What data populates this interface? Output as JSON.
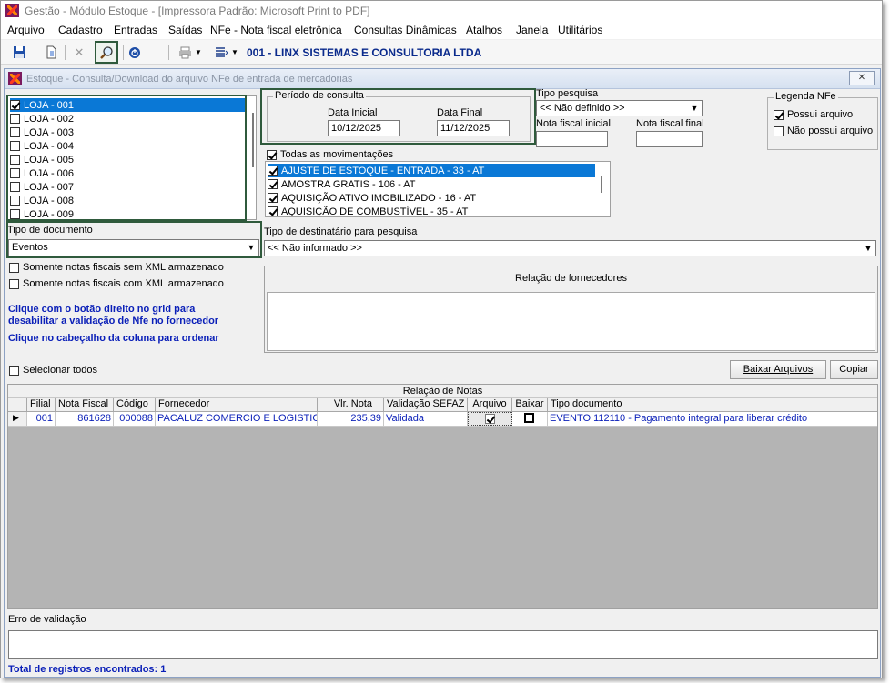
{
  "window": {
    "title": "Gestão  - Módulo Estoque - [Impressora Padrão: Microsoft Print to PDF]"
  },
  "menu": [
    "Arquivo",
    "Cadastro",
    "Entradas",
    "Saídas",
    "NFe - Nota fiscal eletrônica",
    "Consultas Dinâmicas",
    "Atalhos",
    "Janela",
    "Utilitários"
  ],
  "toolbar": {
    "company": "001 - LINX SISTEMAS E CONSULTORIA LTDA",
    "icons": [
      "save-icon",
      "new-document-icon",
      "close-icon",
      "search-icon",
      "power-icon",
      "printer-icon",
      "list-icon"
    ]
  },
  "form": {
    "title": "Estoque - Consulta/Download do arquivo NFe de entrada de mercadorias",
    "close_label": "✕"
  },
  "stores": [
    {
      "label": "LOJA - 001",
      "checked": true,
      "selected": true
    },
    {
      "label": "LOJA - 002",
      "checked": false
    },
    {
      "label": "LOJA - 003",
      "checked": false
    },
    {
      "label": "LOJA - 004",
      "checked": false
    },
    {
      "label": "LOJA - 005",
      "checked": false
    },
    {
      "label": "LOJA - 006",
      "checked": false
    },
    {
      "label": "LOJA - 007",
      "checked": false
    },
    {
      "label": "LOJA - 008",
      "checked": false
    },
    {
      "label": "LOJA - 009",
      "checked": false
    }
  ],
  "period": {
    "title": "Período de consulta",
    "start_label": "Data Inicial",
    "start_value": "10/12/2025",
    "end_label": "Data Final",
    "end_value": "11/12/2025"
  },
  "search_type": {
    "label": "Tipo pesquisa",
    "value": "<< Não definido >>"
  },
  "invoice_range": {
    "start_label": "Nota fiscal inicial",
    "end_label": "Nota fiscal final"
  },
  "legend": {
    "title": "Legenda NFe",
    "has_file": "Possui arquivo",
    "no_file": "Não possui arquivo"
  },
  "movements": {
    "all_label": "Todas as movimentações",
    "items": [
      {
        "label": "AJUSTE DE ESTOQUE - ENTRADA - 33 - AT",
        "selected": true
      },
      {
        "label": "AMOSTRA GRATIS - 106 - AT"
      },
      {
        "label": "AQUISIÇÃO ATIVO IMOBILIZADO - 16 - AT"
      },
      {
        "label": "AQUISIÇÃO DE COMBUSTÍVEL - 35 - AT"
      }
    ]
  },
  "doc_type": {
    "label": "Tipo de documento",
    "value": "Eventos"
  },
  "recipient_type": {
    "label": "Tipo de destinatário para pesquisa",
    "value": "<< Não informado >>"
  },
  "filters": {
    "without_xml": "Somente notas fiscais sem XML armazenado",
    "with_xml": "Somente notas fiscais com XML armazenado"
  },
  "notes": {
    "line1": "Clique com o botão direito no grid para",
    "line2": "desabilitar a validação de Nfe no fornecedor",
    "line3": "Clique no cabeçalho da coluna para ordenar"
  },
  "suppliers": {
    "title": "Relação de fornecedores"
  },
  "select_all": "Selecionar todos",
  "buttons": {
    "download": "Baixar Arquivos",
    "copy": "Copiar"
  },
  "invoices": {
    "title": "Relação de Notas",
    "columns": [
      "Filial",
      "Nota Fiscal",
      "Código",
      "Fornecedor",
      "Vlr. Nota",
      "Validação SEFAZ",
      "Arquivo",
      "Baixar",
      "Tipo documento"
    ],
    "rows": [
      {
        "branch": "001",
        "invoice": "861628",
        "code": "000088",
        "supplier": "PACALUZ COMERCIO E LOGISTIC.",
        "value": "235,39",
        "validation": "Validada",
        "doc_type": "EVENTO 112110 - Pagamento integral para liberar crédito"
      }
    ]
  },
  "validation_error": {
    "label": "Erro de validação"
  },
  "footer": {
    "total": "Total de registros encontrados: 1"
  }
}
